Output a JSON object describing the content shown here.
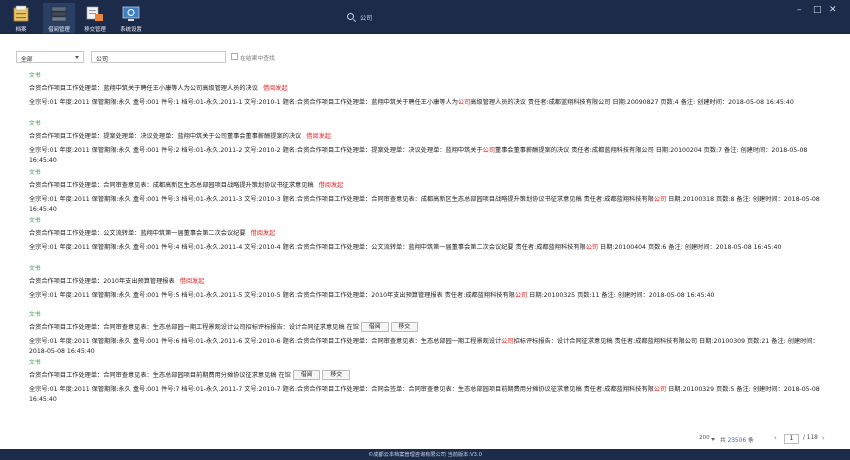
{
  "toolbar": {
    "items": [
      {
        "label": "档案",
        "icon": "file-cabinet-icon"
      },
      {
        "label": "借阅管理",
        "icon": "book-stack-icon"
      },
      {
        "label": "移交管理",
        "icon": "handover-icon"
      },
      {
        "label": "系统设置",
        "icon": "system-settings-icon"
      }
    ],
    "search_text": "公司",
    "controls": {
      "minimize": "–",
      "maximize": "□",
      "close": "✕"
    }
  },
  "query": {
    "scope_value": "全部",
    "keyword_value": "公司",
    "refine_label": "在结果中查找"
  },
  "records": [
    {
      "type": "文书",
      "title": "合资合作项目工作处理单：蓝翔中筑关于聘任王小康等人为公司高级管理人员的决议",
      "action": "借阅发起",
      "buttons": [],
      "detail_pre": "全宗号:01 年度:2011 保管期限:永久 盒号:001 件号:1 档号:01-永久.2011-1 文号:2010-1 题名:合资合作项目工作处理单：蓝翔中筑关于聘任王小康等人为",
      "detail_hl": "公司",
      "detail_post": "高级管理人员的决议 责任者:成都蓝翔科技有限公司 日期:20090827 页数:4 备注: 创建时间：2018-05-08 16:45:40"
    },
    {
      "type": "文书",
      "title": "合资合作项目工作处理单：提案处理单：决议处理单：蓝翔中筑关于公司董事会董事薪酬提案的决议",
      "action": "借阅发起",
      "buttons": [],
      "detail_pre": "全宗号:01 年度:2011 保管期限:永久 盒号:001 件号:2 档号:01-永久.2011-2 文号:2010-2 题名:合资合作项目工作处理单：提案处理单：决议处理单：蓝翔中筑关于",
      "detail_hl": "公司",
      "detail_post": "董事会董事薪酬提案的决议 责任者:成都蓝翔科技有限公司 日期:20100204 页数:7 备注: 创建时间：2018-05-08 16:45:40"
    },
    {
      "type": "文书",
      "title": "合资合作项目工作处理单：合同审查意见表：成都高新区生态总部园项目战略提升策划协议书征求意见稿",
      "action": "借阅发起",
      "buttons": [],
      "detail_pre": "全宗号:01 年度:2011 保管期限:永久 盒号:001 件号:3 档号:01-永久.2011-3 文号:2010-3 题名:合资合作项目工作处理单：合同审查意见表：成都高新区生态总部园项目战略提升策划协议书征求意见稿 责任者:成都蓝翔科技有限",
      "detail_hl": "公司",
      "detail_post": " 日期:20100318 页数:8 备注: 创建时间：2018-05-08 16:45:40"
    },
    {
      "type": "文书",
      "title": "合资合作项目工作处理单：公文流转单：蓝翔中筑第一届董事会第二次会议纪要",
      "action": "借阅发起",
      "buttons": [],
      "detail_pre": "全宗号:01 年度:2011 保管期限:永久 盒号:001 件号:4 档号:01-永久.2011-4 文号:2010-4 题名:合资合作项目工作处理单：公文流转单：蓝翔中筑第一届董事会第二次会议纪要 责任者:成都蓝翔科技有限",
      "detail_hl": "公司",
      "detail_post": " 日期:20100404 页数:6 备注: 创建时间：2018-05-08 16:45:40"
    },
    {
      "type": "文书",
      "title": "合资合作项目工作处理单：2010年支出预算管理报表",
      "action": "借阅发起",
      "buttons": [],
      "detail_pre": "全宗号:01 年度:2011 保管期限:永久 盒号:001 件号:5 档号:01-永久.2011-5 文号:2010-5 题名:合资合作项目工作处理单：2010年支出预算管理报表 责任者:成都蓝翔科技有限",
      "detail_hl": "公司",
      "detail_post": " 日期:20100325 页数:11 备注: 创建时间：2018-05-08 16:45:40"
    },
    {
      "type": "文书",
      "title": "合资合作项目工作处理单：合同审查意见表：生态总部园一期工程景观设计公司招标评标报告：设计合同征求意见稿 在馆",
      "action": "",
      "buttons": [
        "借阅",
        "移交"
      ],
      "detail_pre": "全宗号:01 年度:2011 保管期限:永久 盒号:001 件号:6 档号:01-永久.2011-6 文号:2010-6 题名:合资合作项目工作处理单：合同审查意见表：生态总部园一期工程景观设计",
      "detail_hl": "公司",
      "detail_post": "招标评标报告：设计合同征求意见稿 责任者:成都蓝翔科技有限公司 日期:20100309 页数:21 备注: 创建时间：2018-05-08 16:45:40"
    },
    {
      "type": "文书",
      "title": "合资合作项目工作处理单：合同审查意见表：生态总部园项目前期费用分摊协议征求意见稿 在馆",
      "action": "",
      "buttons": [
        "借阅",
        "移交"
      ],
      "detail_pre": "全宗号:01 年度:2011 保管期限:永久 盒号:001 件号:7 档号:01-永久.2011-7 文号:2010-7 题名:合资合作项目工作处理单：合同会签单：合同审查意见表：生态总部园项目前期费用分摊协议征求意见稿 责任者:成都蓝翔科技有限",
      "detail_hl": "公司",
      "detail_post": " 日期:20100329 页数:5 备注: 创建时间：2018-05-08 16:45:40"
    }
  ],
  "pager": {
    "page_size": "200",
    "total_prefix": "共",
    "total_count": "23506",
    "total_suffix": "条",
    "prev": "‹",
    "current_page": "1",
    "page_count": "/ 118",
    "next": "›"
  },
  "footer": {
    "copyright": "©成都云本档案管理咨询有限公司 当前版本:V3.0"
  },
  "colors": {
    "topbar": "#1b2b49",
    "highlight": "#e02020",
    "type_label": "#2e9a2e",
    "count": "#2a6ad1"
  }
}
